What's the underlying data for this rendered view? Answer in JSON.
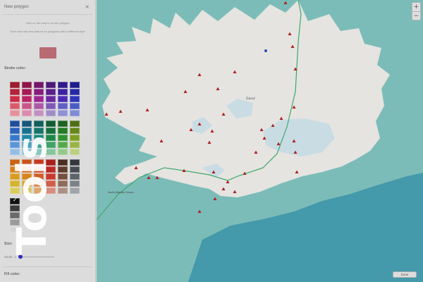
{
  "panel": {
    "title": "New polygon",
    "close_glyph": "×",
    "instruction_1": "Click on the map to set the polygon",
    "instruction_2": "Save and add new feature for polygons with a different style",
    "preview_color": "#b86b72",
    "stroke_color_label": "Stroke color:",
    "size_label": "Size:",
    "width_label": "Width: 1",
    "width_value_fraction": 0.05,
    "fill_color_label": "Fill color:",
    "selected_swatch_check": "✓"
  },
  "palette_groups": [
    {
      "rows": [
        [
          "#9b1c2e",
          "#8c1746",
          "#74176a",
          "#4d1a78",
          "#331a8a",
          "#1f1c8c"
        ],
        [
          "#b4223a",
          "#a41b56",
          "#881c7e",
          "#5a1f8c",
          "#3c20a0",
          "#2428a4"
        ],
        [
          "#cc2d46",
          "#bb2464",
          "#9c2590",
          "#6a28a0",
          "#4a2ab4",
          "#2c34b8"
        ],
        [
          "#d85a6a",
          "#c95688",
          "#ad58a4",
          "#7d58b4",
          "#6060c4",
          "#4a5ac4"
        ],
        [
          "#e6919b",
          "#d98cad",
          "#c490c0",
          "#a08cc8",
          "#9090d4",
          "#7f8ad4"
        ]
      ]
    },
    {
      "rows": [
        [
          "#1f4f9c",
          "#13587a",
          "#125f5b",
          "#135c33",
          "#1c6420",
          "#4e6e14"
        ],
        [
          "#2a63b8",
          "#167090",
          "#157468",
          "#14703c",
          "#247a26",
          "#65861a"
        ],
        [
          "#3778cc",
          "#1f88a8",
          "#188a7a",
          "#1b8848",
          "#2f922e",
          "#7c9e22"
        ],
        [
          "#5a96d8",
          "#4aa0c0",
          "#3ea496",
          "#3fa266",
          "#54aa4a",
          "#98b444"
        ],
        [
          "#93bde6",
          "#8ac4d6",
          "#84c8bc",
          "#86c69c",
          "#94ca88",
          "#bad082"
        ]
      ]
    },
    {
      "rows": [
        [
          "#c86414",
          "#c8541a",
          "#c43a1e",
          "#a8201c",
          "#4a2e22",
          "#33383c"
        ],
        [
          "#d8801a",
          "#d06a20",
          "#cc4a24",
          "#bb2a24",
          "#5e3c2e",
          "#454c52"
        ],
        [
          "#d89c22",
          "#d6861e",
          "#d05e28",
          "#c83a2e",
          "#74503e",
          "#5c6468"
        ],
        [
          "#d4b42c",
          "#d8a432",
          "#d8843c",
          "#d05e48",
          "#8e6a58",
          "#7a8286"
        ],
        [
          "#d8cc5a",
          "#dcc062",
          "#dca86c",
          "#d88c7c",
          "#ac9084",
          "#9ea4a8"
        ]
      ]
    },
    {
      "rows": [
        [
          "#111111"
        ],
        [
          "#3a3a3a"
        ],
        [
          "#6a6a6a"
        ],
        [
          "#9a9a9a"
        ],
        [
          "#d4d4d4"
        ]
      ]
    }
  ],
  "map": {
    "label_island": "Ísland",
    "label_town": "North Atlantic Ocean",
    "zoom_in": "+",
    "zoom_out": "−",
    "done_label": "Done",
    "water_color": "#78c6c2",
    "deep_water_color": "#3aa3b7",
    "land_color": "#efeee8",
    "glacier_color": "#cfe6ef",
    "route_color": "#33b36b",
    "marker_color": "#c51f1f"
  }
}
